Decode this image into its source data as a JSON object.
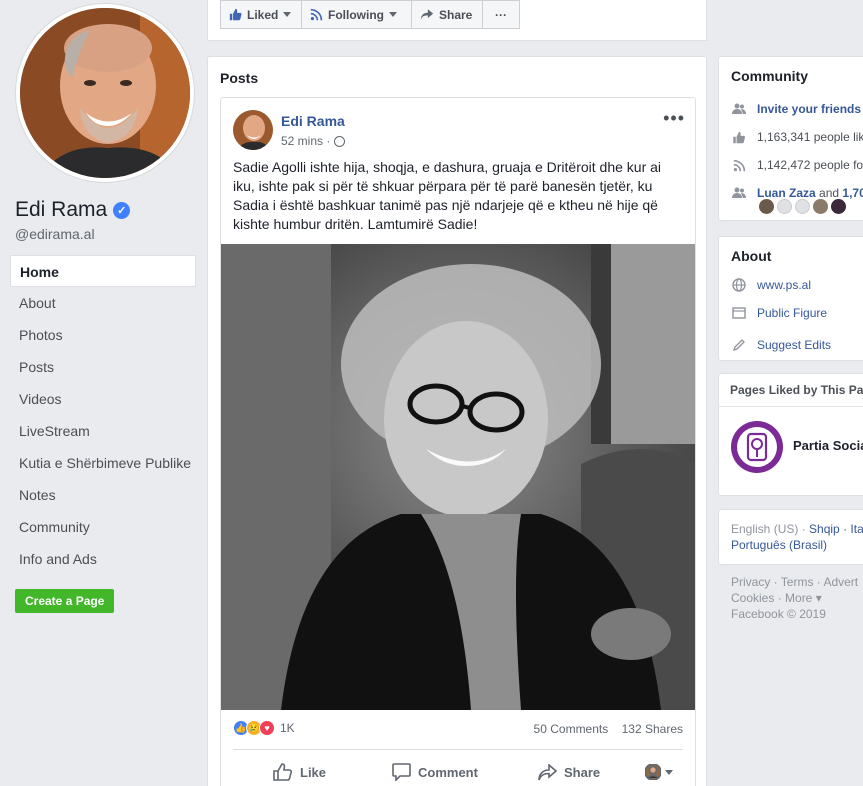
{
  "profile": {
    "name": "Edi Rama",
    "username": "@edirama.al",
    "verified_glyph": "✓"
  },
  "nav": {
    "items": [
      {
        "label": "Home"
      },
      {
        "label": "About"
      },
      {
        "label": "Photos"
      },
      {
        "label": "Posts"
      },
      {
        "label": "Videos"
      },
      {
        "label": "LiveStream"
      },
      {
        "label": "Kutia e Shërbimeve Publike"
      },
      {
        "label": "Notes"
      },
      {
        "label": "Community"
      },
      {
        "label": "Info and Ads"
      }
    ],
    "create_page": "Create a Page"
  },
  "actionbar": {
    "liked": "Liked",
    "following": "Following",
    "share": "Share",
    "more": "···"
  },
  "posts": {
    "title": "Posts",
    "author": "Edi Rama",
    "time": "52 mins ·",
    "more": "•••",
    "text": "Sadie Agolli ishte hija, shoqja, e dashura, gruaja e Dritëroit dhe kur ai iku, ishte pak si për të shkuar përpara për të parë banesën tjetër, ku Sadia i është bashkuar tanimë pas një ndarjeje që e ktheu në hije që kishte humbur dritën. Lamtumirë Sadie!",
    "reaction_count": "1K",
    "comments": "50 Comments",
    "shares": "132 Shares",
    "like": "Like",
    "comment": "Comment",
    "share": "Share"
  },
  "community": {
    "title": "Community",
    "invite": "Invite your friends",
    "likes": "1,163,341 people lik",
    "follows": "1,142,472 people fo",
    "friend_name": "Luan Zaza",
    "friend_and": " and ",
    "friend_count": "1,70"
  },
  "about": {
    "title": "About",
    "website": "www.ps.al",
    "category": "Public Figure",
    "suggest": "Suggest Edits"
  },
  "pages_liked": {
    "title": "Pages Liked by This Pa",
    "page_name": "Partia Socia"
  },
  "languages": {
    "line1_a": "English (US)",
    "line1_sep": " · ",
    "line1_b": "Shqip",
    "line1_c": " · Ita",
    "line2": "Português (Brasil)"
  },
  "footer": {
    "line1": "Privacy · Terms · Advert",
    "line2": "Cookies · More ▾",
    "line3": "Facebook © 2019"
  },
  "colors": {
    "link": "#365899",
    "accent": "#4267b2",
    "create_button": "#42b72a",
    "party_purple": "#7b2a96"
  }
}
